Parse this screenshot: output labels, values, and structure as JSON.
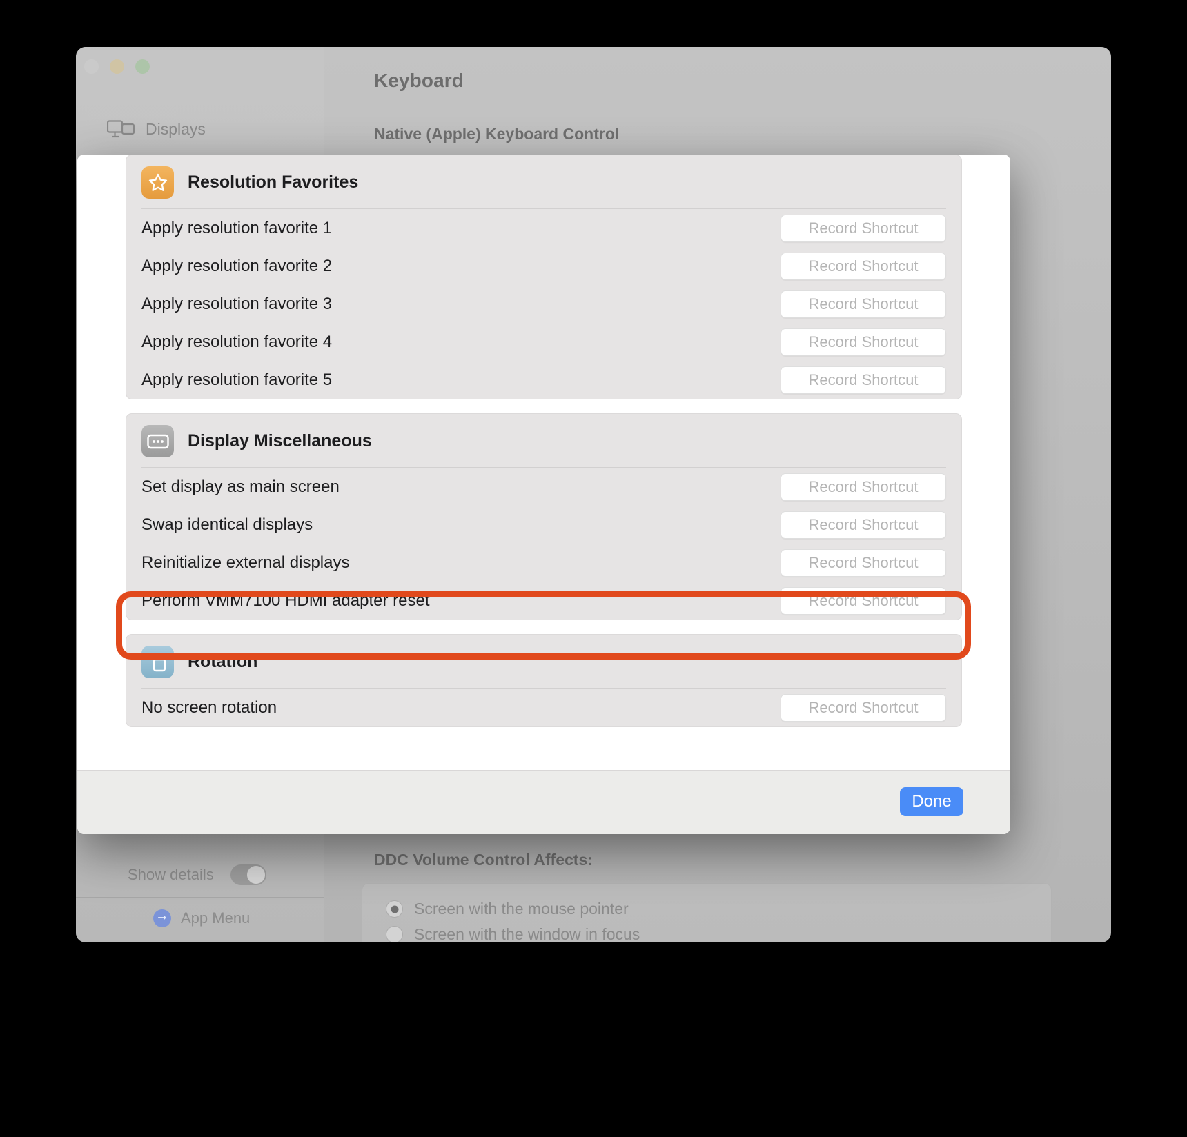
{
  "window": {
    "traffic_lights": [
      "close",
      "minimize",
      "maximize"
    ],
    "pane_title": "Keyboard",
    "section_subtitle": "Native (Apple) Keyboard Control",
    "sidebar": {
      "item_label": "Displays",
      "icon": "displays-icon",
      "show_details_label": "Show details",
      "show_details_on": true,
      "app_menu_label": "App Menu",
      "app_menu_icon": "arrow-right-circle-icon"
    },
    "ddc": {
      "title": "DDC Volume Control Affects:",
      "options": [
        {
          "label": "Screen with the mouse pointer",
          "selected": true
        },
        {
          "label": "Screen with the window in focus",
          "selected": false
        }
      ]
    }
  },
  "sheet": {
    "record_button_label": "Record Shortcut",
    "done_label": "Done",
    "groups": [
      {
        "title": "Resolution Favorites",
        "icon": "star-icon",
        "icon_style": "star",
        "rows": [
          {
            "label": "Apply resolution favorite 1"
          },
          {
            "label": "Apply resolution favorite 2"
          },
          {
            "label": "Apply resolution favorite 3"
          },
          {
            "label": "Apply resolution favorite 4"
          },
          {
            "label": "Apply resolution favorite 5"
          }
        ]
      },
      {
        "title": "Display Miscellaneous",
        "icon": "ellipsis-box-icon",
        "icon_style": "misc",
        "rows": [
          {
            "label": "Set display as main screen"
          },
          {
            "label": "Swap identical displays"
          },
          {
            "label": "Reinitialize external displays"
          },
          {
            "label": "Perform VMM7100 HDMI adapter reset",
            "highlighted": true
          }
        ]
      },
      {
        "title": "Rotation",
        "icon": "rotate-square-icon",
        "icon_style": "rotation",
        "rows": [
          {
            "label": "No screen rotation"
          }
        ]
      }
    ]
  },
  "colors": {
    "annotation": "#e1491c",
    "done_button": "#4a8cf7",
    "star_icon_bg": "#e59b3d",
    "misc_icon_bg": "#9a9a9a",
    "rotation_icon_bg": "#84b2c9",
    "group_bg": "#e6e4e4",
    "sheet_bg": "#ffffff"
  }
}
